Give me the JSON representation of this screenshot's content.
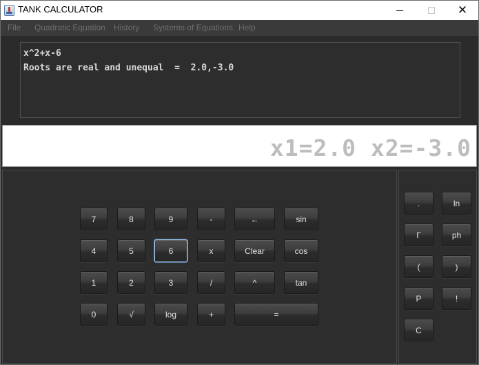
{
  "window": {
    "title": "TANK CALCULATOR",
    "minimize": "",
    "maximize": "",
    "close": "✕"
  },
  "menu": [
    "File",
    "Quadratic Equation",
    "History",
    "Systems of Equations",
    "Help"
  ],
  "history": {
    "lines": [
      "x^2+x-6",
      "Roots are real and unequal  =  2.0,-3.0"
    ]
  },
  "display": {
    "value": "x1=2.0 x2=-3.0"
  },
  "keypad": {
    "k7": "7",
    "k8": "8",
    "k9": "9",
    "minus": "-",
    "backspace": "←",
    "sin": "sin",
    "k4": "4",
    "k5": "5",
    "k6": "6",
    "times": "x",
    "clear": "Clear",
    "cos": "cos",
    "k1": "1",
    "k2": "2",
    "k3": "3",
    "divide": "/",
    "power": "^",
    "tan": "tan",
    "k0": "0",
    "sqrt": "√",
    "log": "log",
    "plus": "+",
    "equals": "="
  },
  "side": {
    "dot": ".",
    "ln": "ln",
    "gamma": "Γ",
    "ph": "ph",
    "lparen": "(",
    "rparen": ")",
    "perm": "P",
    "fact": "!",
    "comb": "C"
  }
}
